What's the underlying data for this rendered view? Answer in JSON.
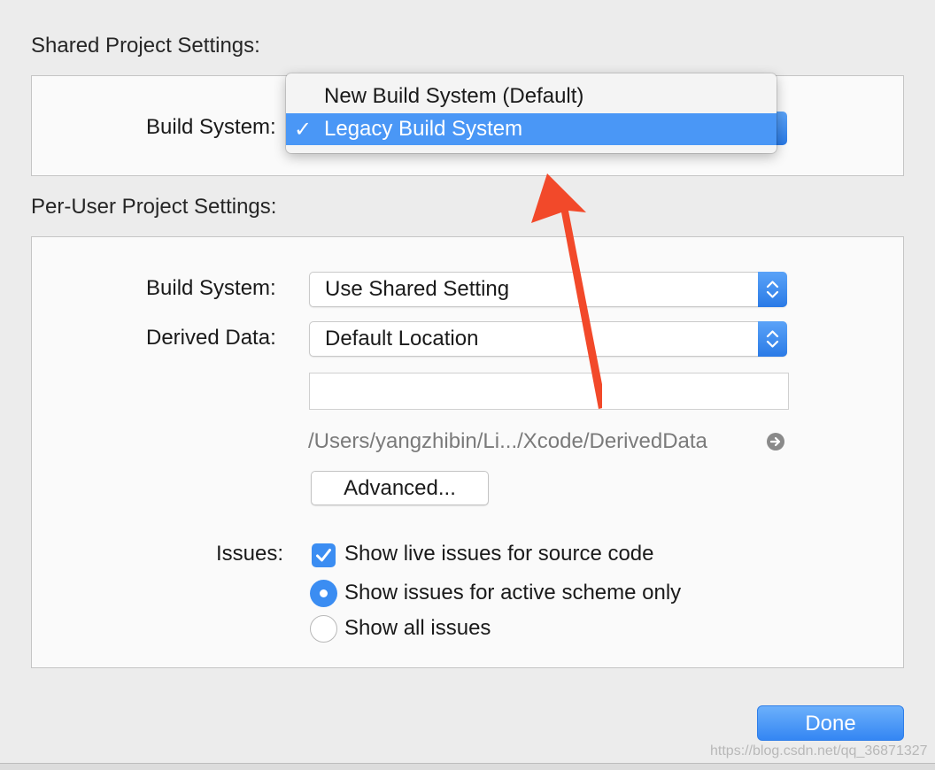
{
  "shared": {
    "title": "Shared Project Settings:",
    "build_system_label": "Build System:",
    "menu": {
      "items": [
        {
          "label": "New Build System (Default)",
          "selected": false
        },
        {
          "label": "Legacy Build System",
          "selected": true
        }
      ],
      "check_glyph": "✓"
    }
  },
  "per_user": {
    "title": "Per-User Project Settings:",
    "build_system_label": "Build System:",
    "build_system_value": "Use Shared Setting",
    "derived_data_label": "Derived Data:",
    "derived_data_value": "Default Location",
    "custom_path_value": "",
    "derived_path": "/Users/yangzhibin/Li.../Xcode/DerivedData",
    "advanced_button": "Advanced...",
    "issues_label": "Issues:",
    "live_issues_label": "Show live issues for source code",
    "live_issues_checked": true,
    "scheme_issues_label": "Show issues for active scheme only",
    "all_issues_label": "Show all issues",
    "issues_mode": "active-scheme"
  },
  "footer": {
    "done_button": "Done",
    "watermark": "https://blog.csdn.net/qq_36871327"
  },
  "colors": {
    "accent": "#3b8df2",
    "annotation_arrow": "#f2492a",
    "window_bg": "#ececec"
  }
}
